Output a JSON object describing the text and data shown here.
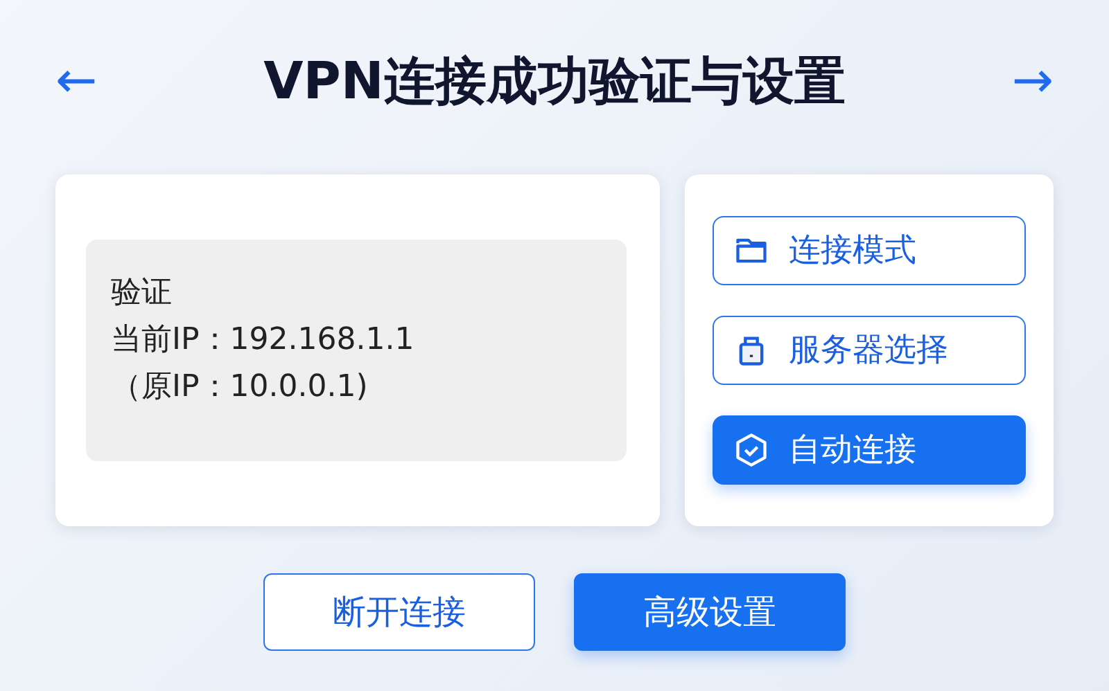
{
  "header": {
    "back": "←",
    "title": "VPN连接成功验证与设置",
    "forward": "→"
  },
  "verification": {
    "lines": [
      "验证",
      "当前IP：192.168.1.1",
      "（原IP：10.0.0.1)"
    ]
  },
  "side_buttons": [
    {
      "label": "连接模式",
      "highlighted": false
    },
    {
      "label": "服务器选择",
      "highlighted": false
    },
    {
      "label": "自动连接",
      "highlighted": true
    }
  ],
  "bottom_buttons": [
    {
      "label": "断开连接",
      "highlighted": false
    },
    {
      "label": "高级设置",
      "highlighted": true
    }
  ]
}
